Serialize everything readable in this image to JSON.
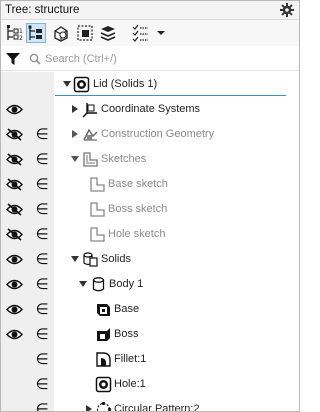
{
  "window": {
    "title": "Tree: structure"
  },
  "toolbar": {
    "buttons": [
      {
        "icon": "tree-view-icon"
      },
      {
        "icon": "tree-structure-icon",
        "active": true
      },
      {
        "icon": "show-objects-icon"
      },
      {
        "icon": "selection-box-icon"
      },
      {
        "icon": "layers-icon"
      },
      {
        "icon": "list-options-icon"
      }
    ]
  },
  "search": {
    "placeholder": "Search (Ctrl+/)"
  },
  "tree": {
    "rows": [
      {
        "label": "Lid (Solids  1)",
        "visibility": "none",
        "element": "",
        "dim": false
      },
      {
        "label": "Coordinate Systems",
        "visibility": "visible",
        "element": "",
        "dim": false
      },
      {
        "label": "Construction Geometry",
        "visibility": "hidden",
        "element": "∈",
        "dim": true
      },
      {
        "label": "Sketches",
        "visibility": "hidden",
        "element": "∈",
        "dim": true
      },
      {
        "label": "Base sketch",
        "visibility": "hidden",
        "element": "∈",
        "dim": true
      },
      {
        "label": "Boss sketch",
        "visibility": "hidden",
        "element": "∈",
        "dim": true
      },
      {
        "label": "Hole sketch",
        "visibility": "hidden",
        "element": "∈",
        "dim": true
      },
      {
        "label": "Solids",
        "visibility": "visible",
        "element": "∈",
        "dim": false
      },
      {
        "label": "Body 1",
        "visibility": "visible",
        "element": "∈",
        "dim": false
      },
      {
        "label": "Base",
        "visibility": "visible",
        "element": "∈",
        "dim": false
      },
      {
        "label": "Boss",
        "visibility": "visible",
        "element": "∈",
        "dim": false
      },
      {
        "label": "Fillet:1",
        "visibility": "none",
        "element": "∈",
        "dim": false
      },
      {
        "label": "Hole:1",
        "visibility": "none",
        "element": "∈",
        "dim": false
      },
      {
        "label": "Circular Pattern:2",
        "visibility": "none",
        "element": "∈",
        "dim": false
      }
    ]
  },
  "colors": {
    "accent": "#3a8fd0",
    "selected_button": "#cfe6f8",
    "gutter": "#efefef"
  }
}
